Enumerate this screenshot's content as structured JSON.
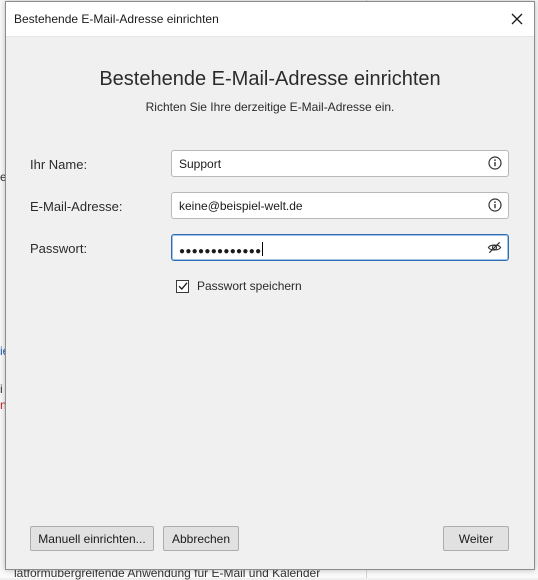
{
  "background": {
    "fragments": [
      "e",
      "ie",
      "i",
      "n",
      "latformübergreifende Anwendung für E-Mail und Kalender"
    ]
  },
  "window": {
    "title": "Bestehende E-Mail-Adresse einrichten"
  },
  "header": {
    "title": "Bestehende E-Mail-Adresse einrichten",
    "subtitle": "Richten Sie Ihre derzeitige E-Mail-Adresse ein."
  },
  "form": {
    "name": {
      "label": "Ihr Name:",
      "value": "Support"
    },
    "email": {
      "label": "E-Mail-Adresse:",
      "value": "keine@beispiel-welt.de"
    },
    "password": {
      "label": "Passwort:",
      "value": "●●●●●●●●●●●●●"
    },
    "remember": {
      "label": "Passwort speichern",
      "checked": true
    }
  },
  "buttons": {
    "manual": "Manuell einrichten...",
    "cancel": "Abbrechen",
    "next": "Weiter"
  },
  "icons": {
    "close": "close-icon",
    "info": "info-icon",
    "hide_password": "eye-slash-icon",
    "check": "checkmark-icon"
  },
  "colors": {
    "focus_border": "#2f6fb0",
    "dialog_bg": "#f0f0f0",
    "link_blue": "#1a5fb4",
    "error_red": "#c01c28"
  }
}
